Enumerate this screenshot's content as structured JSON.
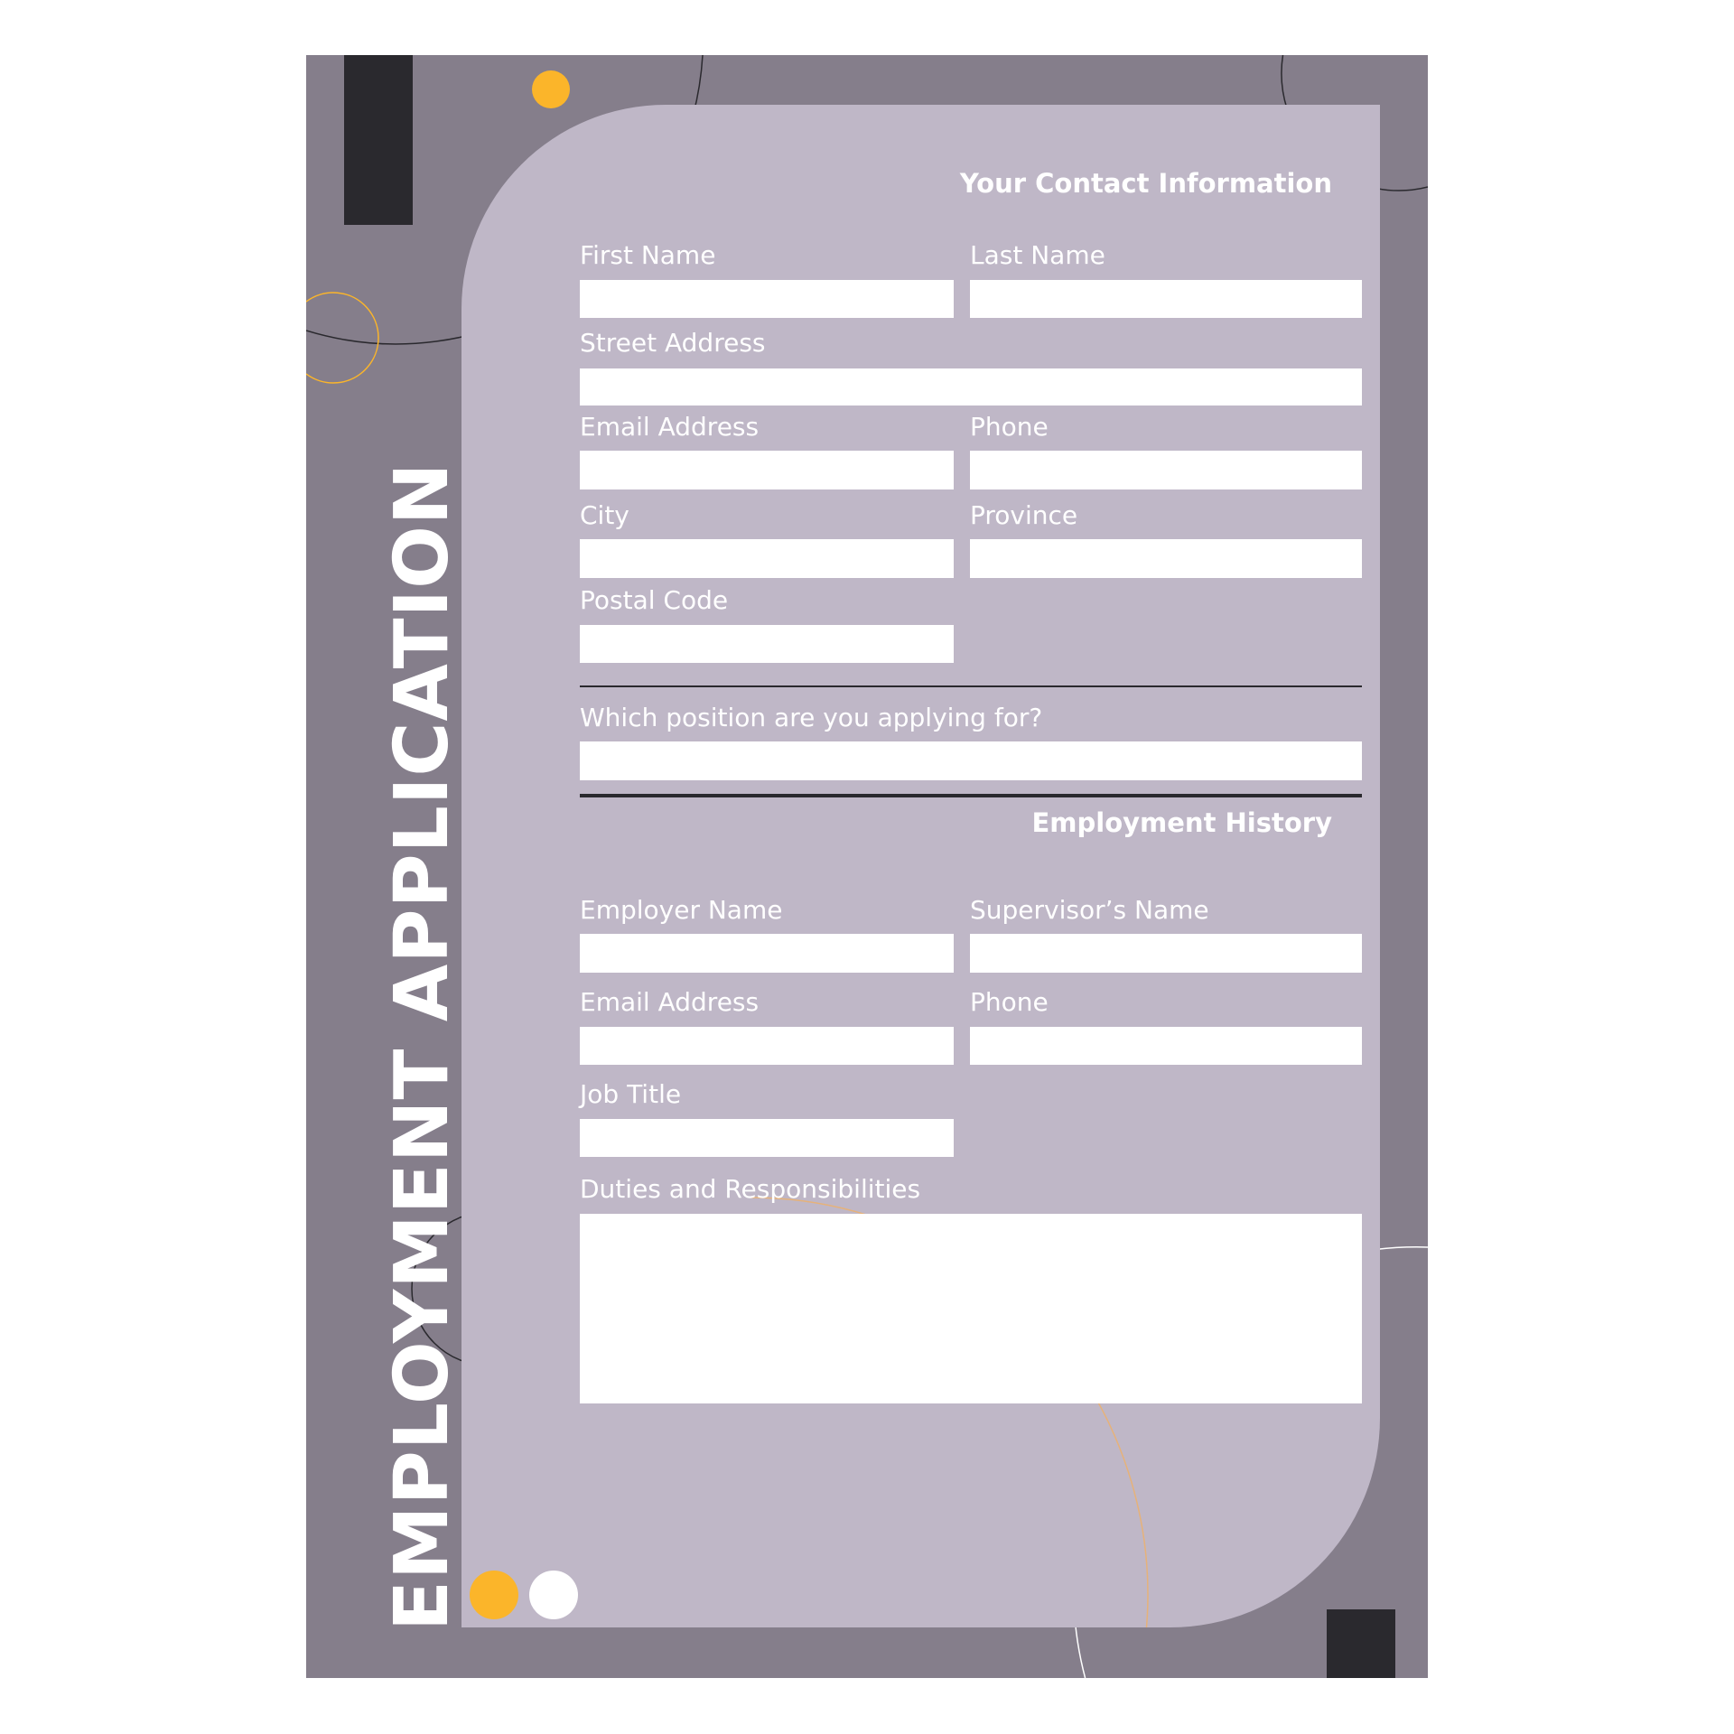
{
  "title": "EMPLOYMENT APPLICATION",
  "colors": {
    "background": "#857e8b",
    "panel": "#bfb7c7",
    "dark": "#2a292e",
    "accent": "#fbb52a",
    "field": "#ffffff"
  },
  "contact": {
    "heading": "Your Contact Information",
    "first_name": "First Name",
    "last_name": "Last Name",
    "street": "Street Address",
    "email": "Email Address",
    "phone": "Phone",
    "city": "City",
    "province": "Province",
    "postal": "Postal Code"
  },
  "position": {
    "question": "Which position are you applying for?"
  },
  "history": {
    "heading": "Employment History",
    "employer": "Employer Name",
    "supervisor": "Supervisor’s Name",
    "email": "Email Address",
    "phone": "Phone",
    "job_title": "Job Title",
    "duties": "Duties and Responsibilities"
  }
}
